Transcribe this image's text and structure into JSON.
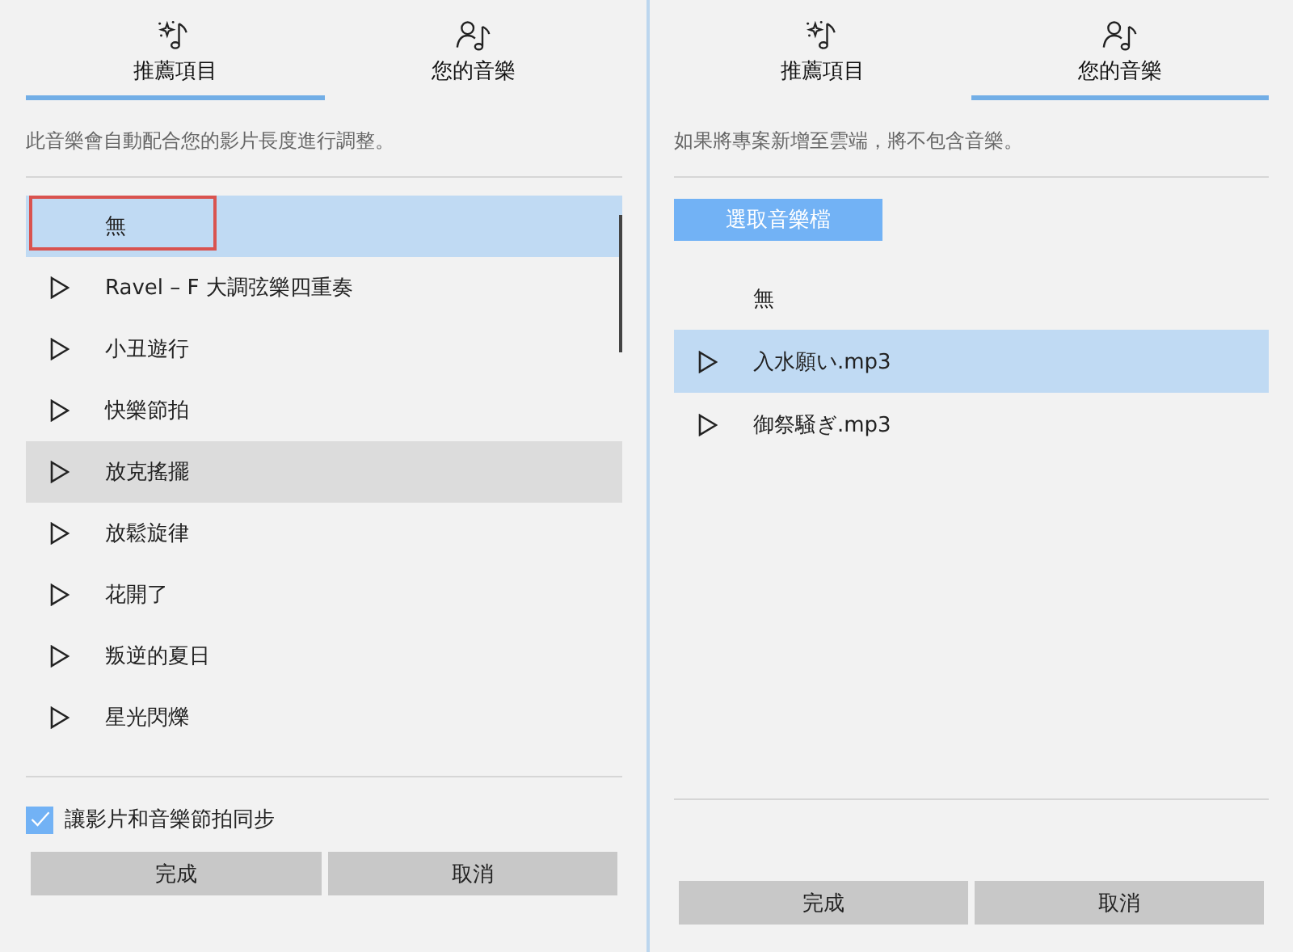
{
  "panels": [
    {
      "tabs": [
        {
          "label": "推薦項目",
          "kind": "sparkle",
          "selected": true
        },
        {
          "label": "您的音樂",
          "kind": "person",
          "selected": false
        }
      ],
      "description": "此音樂會自動配合您的影片長度進行調整。",
      "items": [
        {
          "label": "無",
          "kind": "none",
          "selected": true,
          "hovered": false,
          "outlined": true
        },
        {
          "label": "Ravel – F 大調弦樂四重奏",
          "kind": "track",
          "selected": false,
          "hovered": false,
          "outlined": false
        },
        {
          "label": "小丑遊行",
          "kind": "track",
          "selected": false,
          "hovered": false,
          "outlined": false
        },
        {
          "label": "快樂節拍",
          "kind": "track",
          "selected": false,
          "hovered": false,
          "outlined": false
        },
        {
          "label": "放克搖擺",
          "kind": "track",
          "selected": false,
          "hovered": true,
          "outlined": false
        },
        {
          "label": "放鬆旋律",
          "kind": "track",
          "selected": false,
          "hovered": false,
          "outlined": false
        },
        {
          "label": "花開了",
          "kind": "track",
          "selected": false,
          "hovered": false,
          "outlined": false
        },
        {
          "label": "叛逆的夏日",
          "kind": "track",
          "selected": false,
          "hovered": false,
          "outlined": false
        },
        {
          "label": "星光閃爍",
          "kind": "track",
          "selected": false,
          "hovered": false,
          "outlined": false
        }
      ],
      "sync": {
        "label": "讓影片和音樂節拍同步",
        "checked": true
      },
      "buttons": [
        "完成",
        "取消"
      ]
    },
    {
      "tabs": [
        {
          "label": "推薦項目",
          "kind": "sparkle",
          "selected": false
        },
        {
          "label": "您的音樂",
          "kind": "person",
          "selected": true
        }
      ],
      "description": "如果將專案新增至雲端，將不包含音樂。",
      "pick_button": "選取音樂檔",
      "items": [
        {
          "label": "無",
          "kind": "none",
          "selected": false,
          "hovered": false,
          "outlined": false
        },
        {
          "label": "入水願い.mp3",
          "kind": "track",
          "selected": true,
          "hovered": false,
          "outlined": false
        },
        {
          "label": "御祭騒ぎ.mp3",
          "kind": "track",
          "selected": false,
          "hovered": false,
          "outlined": false
        }
      ],
      "buttons": [
        "完成",
        "取消"
      ]
    }
  ]
}
